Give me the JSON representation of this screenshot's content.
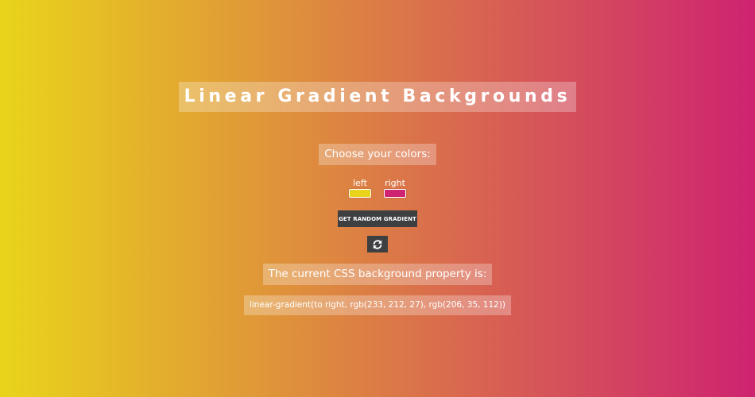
{
  "title": "Linear Gradient Backgrounds",
  "choose_label": "Choose your colors:",
  "pickers": [
    {
      "label": "left",
      "color": "#e9d41b"
    },
    {
      "label": "right",
      "color": "#ce2370"
    }
  ],
  "random_button_label": "GET RANDOM GRADIENT",
  "refresh_icon": "refresh-icon",
  "current_label": "The current CSS background property is:",
  "css_value": "linear-gradient(to right, rgb(233, 212, 27), rgb(206, 35, 112))"
}
